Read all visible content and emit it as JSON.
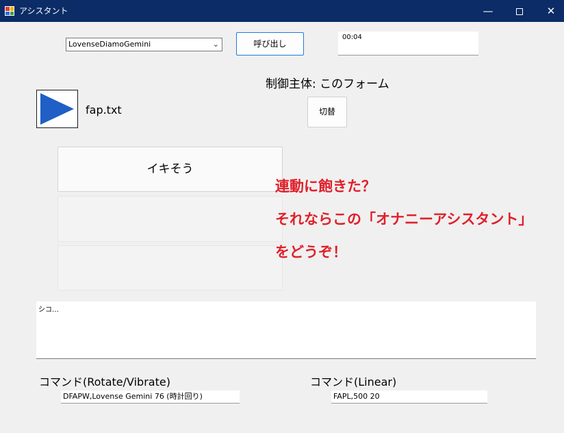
{
  "window": {
    "title": "アシスタント",
    "minimize_glyph": "—",
    "close_glyph": "✕"
  },
  "device_select": {
    "value": "LovenseDiamoGemini"
  },
  "call_button": {
    "label": "呼び出し"
  },
  "timer": {
    "value": "00:04"
  },
  "control": {
    "label": "制御主体: このフォーム",
    "switch_label": "切替"
  },
  "player": {
    "file_name": "fap.txt"
  },
  "actions": {
    "button1_label": "イキそう",
    "button2_label": "",
    "button3_label": ""
  },
  "promo": {
    "line1": "連動に飽きた？",
    "line2": "それならこの「オナニーアシスタント」",
    "line3": "をどうぞ！",
    "color": "#e0202a"
  },
  "log": {
    "text": "シコ…"
  },
  "commands": {
    "rotate_label": "コマンド(Rotate/Vibrate)",
    "rotate_value": "DFAPW,Lovense Gemini 76 (時計回り)",
    "linear_label": "コマンド(Linear)",
    "linear_value": "FAPL,500 20"
  },
  "colors": {
    "titlebar": "#0b2c66",
    "accent": "#1e7be0",
    "play_icon": "#1f5fc6"
  }
}
